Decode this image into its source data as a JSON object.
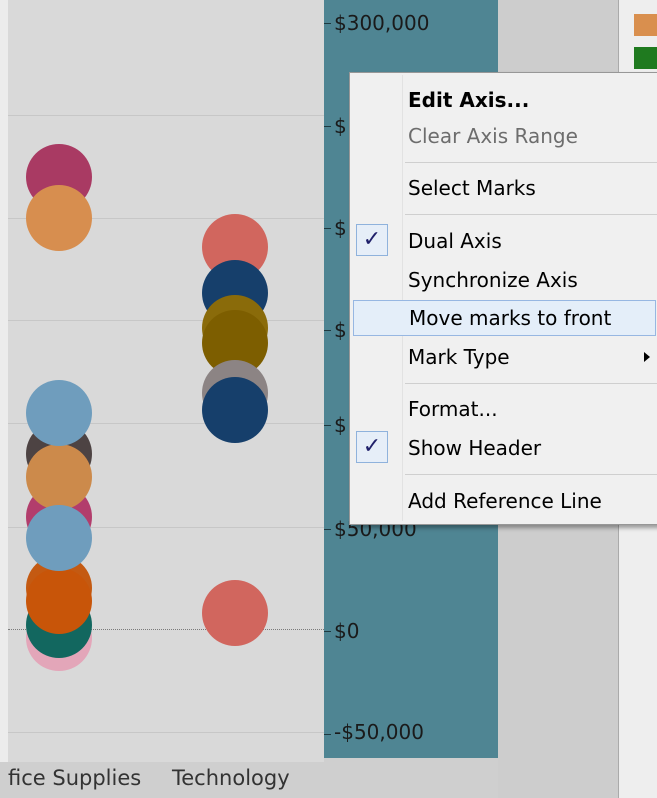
{
  "axis": {
    "tick_labels": [
      "$300,000",
      "$",
      "$",
      "$",
      "$",
      "$50,000",
      "$0",
      "-$50,000"
    ]
  },
  "categories": [
    "fice Supplies",
    "Technology"
  ],
  "context_menu": {
    "items": {
      "edit_axis": "Edit Axis...",
      "clear_axis_range": "Clear Axis Range",
      "select_marks": "Select Marks",
      "dual_axis": "Dual Axis",
      "synchronize_axis": "Synchronize Axis",
      "move_marks_to_front": "Move marks to front",
      "mark_type": "Mark Type",
      "format": "Format...",
      "show_header": "Show Header",
      "add_reference_line": "Add Reference Line"
    },
    "checked": {
      "dual_axis": true,
      "show_header": true
    },
    "check_glyph": "✓",
    "hovered_item": "move_marks_to_front"
  },
  "colors": {
    "axis_panel": "#4f8593",
    "legend_swatches": [
      "#d98f4e",
      "#1f7a1f"
    ]
  }
}
